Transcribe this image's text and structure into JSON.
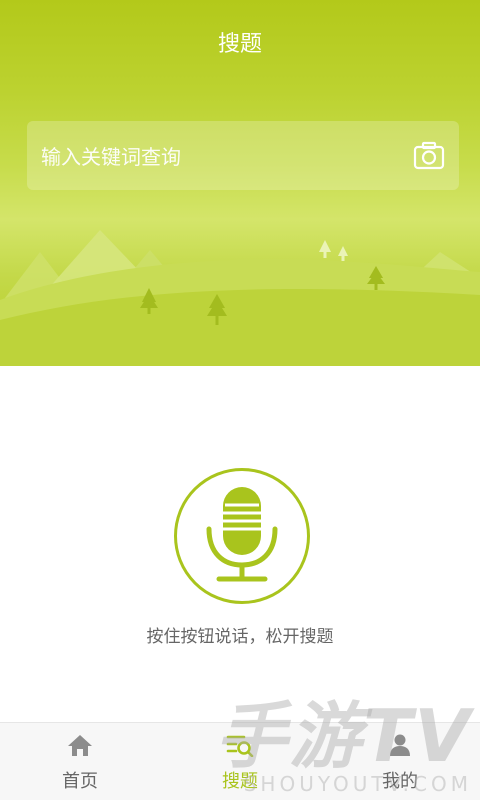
{
  "header": {
    "title": "搜题",
    "search_placeholder": "输入关键词查询"
  },
  "voice": {
    "hint": "按住按钮说话，松开搜题"
  },
  "tabs": [
    {
      "label": "首页",
      "icon": "home-icon",
      "active": false
    },
    {
      "label": "搜题",
      "icon": "search-list-icon",
      "active": true
    },
    {
      "label": "我的",
      "icon": "user-icon",
      "active": false
    }
  ],
  "watermark": {
    "brand": "手游TV",
    "domain": "SHOUYOUTV.COM"
  },
  "colors": {
    "accent": "#a9c41d",
    "header_top": "#b3c91a",
    "tab_inactive": "#666666"
  }
}
